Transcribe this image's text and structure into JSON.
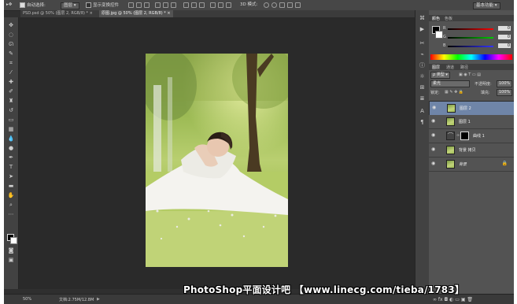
{
  "options_bar": {
    "auto_select_label": "自动选择:",
    "auto_select_value": "图层",
    "show_transform_label": "显示变换控件",
    "mode_3d_label": "3D 模式:",
    "workspace": "基本功能"
  },
  "tabs": [
    {
      "label": "PSD.psd @ 50% (图层 2, RGB/8) *"
    },
    {
      "label": "原图.jpg @ 50% (图层 2, RGB/8) *"
    }
  ],
  "color_panel": {
    "tabs": [
      "颜色",
      "色板"
    ],
    "r_label": "R",
    "r_value": "0",
    "g_label": "G",
    "g_value": "0",
    "b_label": "B",
    "b_value": "0"
  },
  "layers_panel": {
    "tabs": [
      "图层",
      "通道",
      "路径"
    ],
    "filter_label": "ρ 类型",
    "blend_mode": "柔光",
    "opacity_label": "不透明度:",
    "opacity_value": "100%",
    "lock_label": "锁定:",
    "fill_label": "填充:",
    "fill_value": "100%",
    "layers": [
      {
        "name": "图层 2"
      },
      {
        "name": "图层 1"
      },
      {
        "name": "曲线 1"
      },
      {
        "name": "背景 拷贝"
      },
      {
        "name": "背景"
      }
    ]
  },
  "status": {
    "zoom": "50%",
    "doc": "文档:2.75M/12.8M"
  },
  "watermark": "PhotoShop平面设计吧 【www.linecg.com/tieba/1783】",
  "colors": {
    "selected_layer": "#6f85a8",
    "workspace_bg": "#2a2a2a",
    "panel_bg": "#535353"
  }
}
